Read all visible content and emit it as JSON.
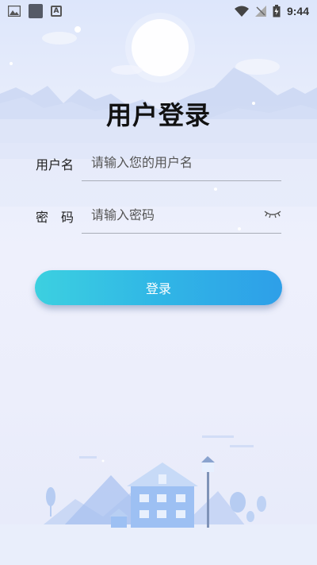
{
  "status_bar": {
    "time": "9:44",
    "icons": [
      "image-icon",
      "app-icon",
      "font-icon",
      "wifi-icon",
      "signal-off-icon",
      "battery-charging-icon"
    ]
  },
  "login": {
    "title": "用户登录",
    "username": {
      "label": "用户名",
      "placeholder": "请输入您的用户名"
    },
    "password": {
      "label": "密　码",
      "placeholder": "请输入密码",
      "toggle_icon": "eye-closed-icon"
    },
    "submit_label": "登录"
  },
  "colors": {
    "button_start": "#3cd0e0",
    "button_end": "#2e9fe8",
    "background": "#e8edfb",
    "title": "#111111"
  }
}
